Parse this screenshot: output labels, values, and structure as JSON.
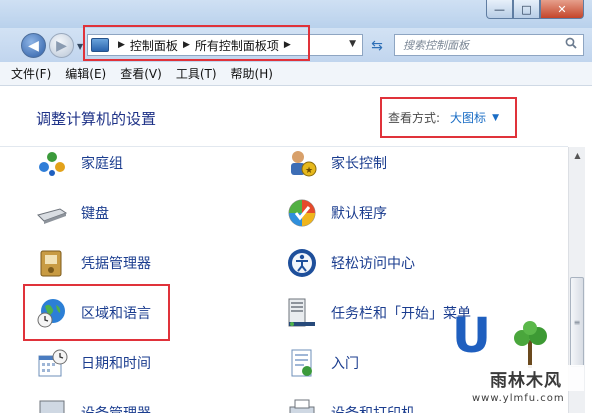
{
  "window": {
    "minimize": "—",
    "maximize": "□",
    "close": "✕"
  },
  "nav": {
    "address": {
      "crumbs": [
        "控制面板",
        "所有控制面板项"
      ]
    },
    "search": {
      "placeholder": "搜索控制面板"
    }
  },
  "menu": {
    "items": [
      "文件(F)",
      "编辑(E)",
      "查看(V)",
      "工具(T)",
      "帮助(H)"
    ]
  },
  "header": {
    "title": "调整计算机的设置",
    "view_label": "查看方式:",
    "view_value": "大图标"
  },
  "items": {
    "homegroup": "家庭组",
    "parental": "家长控制",
    "keyboard": "键盘",
    "default_programs": "默认程序",
    "credential": "凭据管理器",
    "ease_access": "轻松访问中心",
    "region": "区域和语言",
    "taskbar": "任务栏和「开始」菜单",
    "datetime": "日期和时间",
    "getting_started": "入门",
    "device_manager": "设备管理器",
    "devices_printers": "设备和打印机"
  },
  "watermark": {
    "letter": "U",
    "site": "雨林木风",
    "url": "www.ylmfu.com"
  },
  "colors": {
    "highlight_box": "#e0323a",
    "link": "#1b3d8f",
    "title": "#1e3287"
  }
}
